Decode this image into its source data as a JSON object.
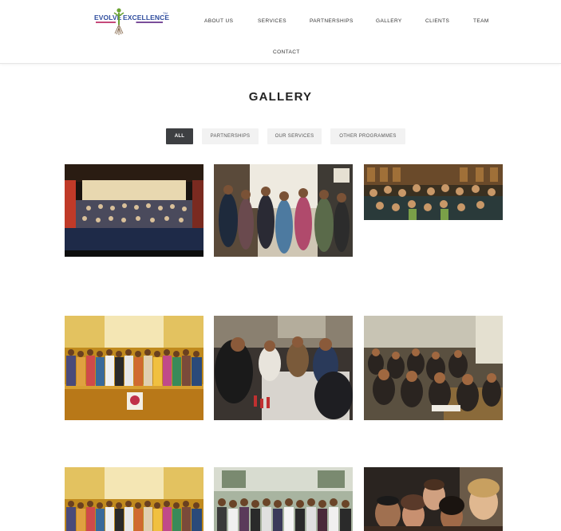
{
  "header": {
    "logo": {
      "text_left": "EVOLVE",
      "text_right": "EXCELLENCE",
      "trademark": "TM"
    },
    "nav": [
      {
        "label": "ABOUT US"
      },
      {
        "label": "SERVICES"
      },
      {
        "label": "PARTNERSHIPS"
      },
      {
        "label": "GALLERY"
      },
      {
        "label": "CLIENTS"
      },
      {
        "label": "TEAM"
      },
      {
        "label": "CONTACT"
      }
    ]
  },
  "main": {
    "title": "GALLERY",
    "filters": [
      {
        "label": "ALL",
        "active": true
      },
      {
        "label": "PARTNERSHIPS",
        "active": false
      },
      {
        "label": "OUR SERVICES",
        "active": false
      },
      {
        "label": "OTHER PROGRAMMES",
        "active": false
      }
    ],
    "gallery": [
      {
        "name": "auditorium-group-photo"
      },
      {
        "name": "workshop-standing-group-photo"
      },
      {
        "name": "library-group-photo"
      },
      {
        "name": "stage-group-photo"
      },
      {
        "name": "table-discussion-photo"
      },
      {
        "name": "classroom-audience-photo"
      },
      {
        "name": "stage-group-photo-2"
      },
      {
        "name": "outdoor-group-photo"
      },
      {
        "name": "selfie-group-photo"
      }
    ]
  }
}
